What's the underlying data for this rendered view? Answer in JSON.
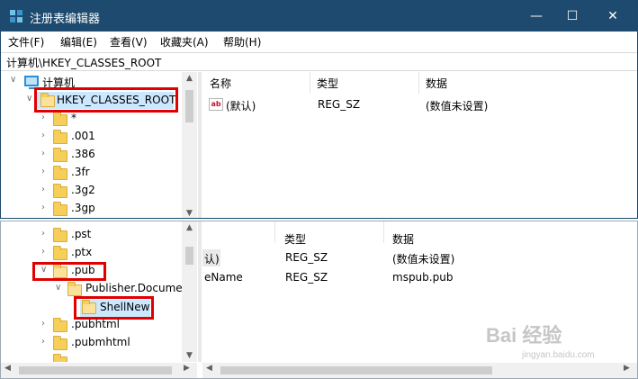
{
  "window": {
    "title": "注册表编辑器",
    "minimize_glyph": "—",
    "maximize_glyph": "☐",
    "close_glyph": "✕"
  },
  "menu": [
    "文件(F)",
    "编辑(E)",
    "查看(V)",
    "收藏夹(A)",
    "帮助(H)"
  ],
  "address": "计算机\\HKEY_CLASSES_ROOT",
  "tree_top": {
    "root_label": "计算机",
    "selected_key": "HKEY_CLASSES_ROOT",
    "children": [
      "*",
      ".001",
      ".386",
      ".3fr",
      ".3g2",
      ".3gp"
    ]
  },
  "list_top": {
    "columns": [
      "名称",
      "类型",
      "数据"
    ],
    "rows": [
      {
        "name": "(默认)",
        "type": "REG_SZ",
        "data": "(数值未设置)",
        "icon": "string-value-icon"
      }
    ]
  },
  "tree_bottom": {
    "items": [
      ".pst",
      ".ptx",
      ".pub",
      "Publisher.Documen",
      "ShellNew",
      ".pubhtml",
      ".pubmhtml"
    ]
  },
  "list_bottom": {
    "columns": [
      "类型",
      "数据"
    ],
    "rows": [
      {
        "name": "认)",
        "type": "REG_SZ",
        "data": "(数值未设置)"
      },
      {
        "name": "eName",
        "type": "REG_SZ",
        "data": "mspub.pub"
      }
    ]
  },
  "watermark": {
    "brand": "Bai 经验",
    "url": "jingyan.baidu.com"
  },
  "colors": {
    "titlebar": "#1d4a6e",
    "selection": "#cce8ff",
    "highlight_box": "#e00000",
    "folder": "#f6cf59"
  }
}
